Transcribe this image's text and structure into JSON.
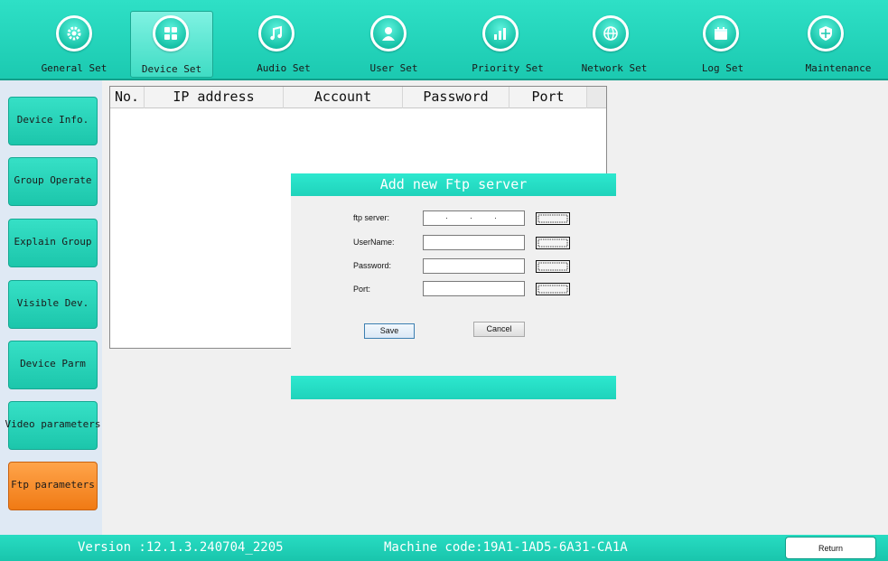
{
  "toolbar": {
    "items": [
      {
        "label": "General Set",
        "icon": "gear-icon"
      },
      {
        "label": "Device Set",
        "icon": "grid-icon"
      },
      {
        "label": "Audio Set",
        "icon": "music-note-icon"
      },
      {
        "label": "User Set",
        "icon": "user-icon"
      },
      {
        "label": "Priority Set",
        "icon": "bar-chart-icon"
      },
      {
        "label": "Network Set",
        "icon": "globe-icon"
      },
      {
        "label": "Log Set",
        "icon": "calendar-icon"
      },
      {
        "label": "Maintenance",
        "icon": "shield-icon"
      }
    ],
    "active": "Device Set"
  },
  "sidebar": {
    "items": [
      {
        "label": "Device Info."
      },
      {
        "label": "Group Operate"
      },
      {
        "label": "Explain Group"
      },
      {
        "label": "Visible Dev."
      },
      {
        "label": "Device Parm"
      },
      {
        "label": "Video parameters"
      },
      {
        "label": "Ftp parameters"
      }
    ],
    "active": "Ftp parameters"
  },
  "table": {
    "columns": [
      "No.",
      "IP address",
      "Account",
      "Password",
      "Port"
    ],
    "rows": []
  },
  "dialog": {
    "title": "Add new Ftp server",
    "fields": {
      "ftp_server": {
        "label": "ftp server:",
        "value": ""
      },
      "username": {
        "label": "UserName:",
        "value": ""
      },
      "password": {
        "label": "Password:",
        "value": ""
      },
      "port": {
        "label": "Port:",
        "value": ""
      }
    },
    "save_label": "Save",
    "cancel_label": "Cancel"
  },
  "status": {
    "version": "Version :12.1.3.240704_2205",
    "machine_code": "Machine code:19A1-1AD5-6A31-CA1A",
    "return_label": "Return"
  },
  "colors": {
    "accent": "#1fd3bb",
    "active_sidebar": "#f07a14"
  }
}
